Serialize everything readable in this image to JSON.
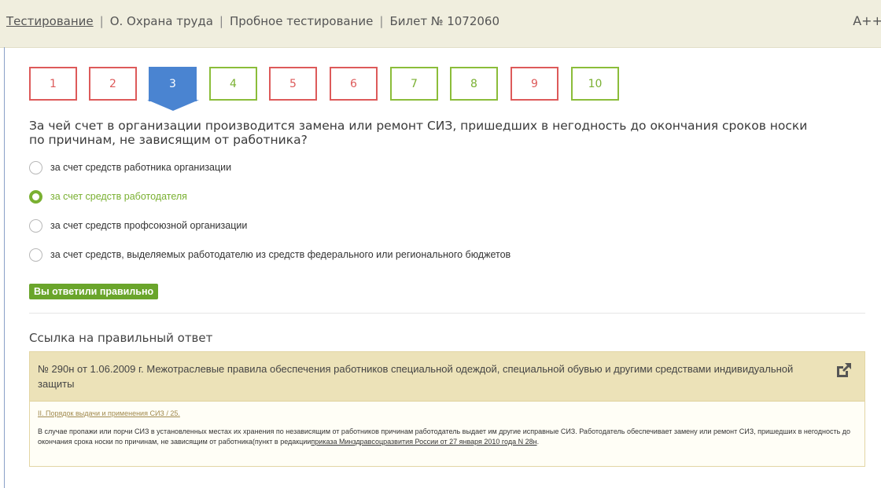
{
  "breadcrumb": {
    "root_link": "Тестирование",
    "items": [
      "О. Охрана труда",
      "Пробное тестирование",
      "Билет № 1072060"
    ],
    "separator": "|",
    "font_toggle": "A++"
  },
  "question_nav": {
    "current": 3,
    "buttons": [
      {
        "label": "1",
        "status": "wrong"
      },
      {
        "label": "2",
        "status": "wrong"
      },
      {
        "label": "3",
        "status": "current"
      },
      {
        "label": "4",
        "status": "correct"
      },
      {
        "label": "5",
        "status": "wrong"
      },
      {
        "label": "6",
        "status": "wrong"
      },
      {
        "label": "7",
        "status": "correct"
      },
      {
        "label": "8",
        "status": "correct"
      },
      {
        "label": "9",
        "status": "wrong"
      },
      {
        "label": "10",
        "status": "correct"
      }
    ]
  },
  "question": {
    "text": "За чей счет в организации производится замена или ремонт СИЗ, пришедших в негодность до окончания сроков носки по причинам, не зависящим от работника?",
    "options": [
      {
        "label": "за счет средств работника организации",
        "selected": false
      },
      {
        "label": "за счет средств работодателя",
        "selected": true
      },
      {
        "label": "за счет средств профсоюзной организации",
        "selected": false
      },
      {
        "label": "за счет средств, выделяемых работодателю из средств федерального или регионального бюджетов",
        "selected": false
      }
    ]
  },
  "result": {
    "text": "Вы ответили правильно"
  },
  "reference": {
    "title": "Ссылка на правильный ответ",
    "document": "№ 290н от 1.06.2009 г. Межотраслевые правила обеспечения работников специальной одеждой, специальной обувью и другими средствами индивидуальной защиты",
    "section": "II. Порядок выдачи и применения СИЗ / 25.",
    "body_text": "В случае пропажи или порчи СИЗ в установленных местах их хранения по независящим от работников причинам работодатель выдает им другие исправные СИЗ. Работодатель обеспечивает замену или ремонт СИЗ, пришедших в негодность до окончания срока носки по причинам, не зависящим от работника(пункт в редакции",
    "body_link": "приказа Минздравсоцразвития России от 27 января 2010 года N 28н",
    "body_end": "."
  },
  "colors": {
    "correct": "#7ab032",
    "wrong": "#dd5a5a",
    "current": "#4a84d1",
    "header_bg": "#f0eede",
    "reference_bg": "#ece2b8"
  },
  "icons": {
    "external_link": "external-link-icon"
  }
}
